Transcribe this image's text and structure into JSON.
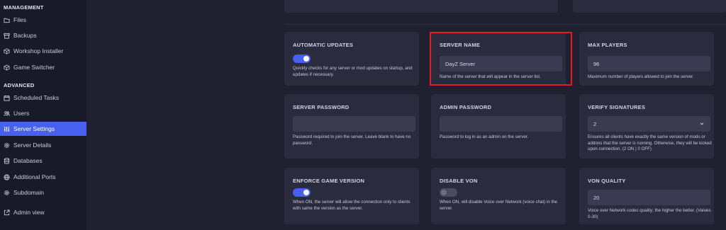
{
  "sidebar": {
    "management_title": "MANAGEMENT",
    "advanced_title": "ADVANCED",
    "management_items": [
      {
        "label": "Files",
        "icon": "folder-icon"
      },
      {
        "label": "Backups",
        "icon": "archive-icon"
      },
      {
        "label": "Workshop Installer",
        "icon": "cube-icon"
      },
      {
        "label": "Game Switcher",
        "icon": "cube-icon"
      }
    ],
    "advanced_items": [
      {
        "label": "Scheduled Tasks",
        "icon": "calendar-icon"
      },
      {
        "label": "Users",
        "icon": "users-icon"
      },
      {
        "label": "Server Settings",
        "icon": "sliders-icon",
        "active": true
      },
      {
        "label": "Server Details",
        "icon": "gear-icon"
      },
      {
        "label": "Databases",
        "icon": "database-icon"
      },
      {
        "label": "Additional Ports",
        "icon": "globe-icon"
      },
      {
        "label": "Subdomain",
        "icon": "gear-icon"
      }
    ],
    "admin_view": "Admin view"
  },
  "settings": {
    "automatic_updates": {
      "title": "AUTOMATIC UPDATES",
      "enabled": true,
      "desc": "Quickly checks for any server or mod updates on startup, and updates if necessary."
    },
    "server_name": {
      "title": "SERVER NAME",
      "value": "DayZ Server",
      "desc": "Name of the server that will appear in the server list."
    },
    "max_players": {
      "title": "MAX PLAYERS",
      "value": "96",
      "desc": "Maximum number of players allowed to join the server."
    },
    "server_password": {
      "title": "SERVER PASSWORD",
      "value": "",
      "desc": "Password required to join the server. Leave blank to have no password."
    },
    "admin_password": {
      "title": "ADMIN PASSWORD",
      "value": "",
      "desc": "Password to log in as an admin on the server."
    },
    "verify_signatures": {
      "title": "VERIFY SIGNATURES",
      "value": "2",
      "desc": "Ensures all clients have exactly the same version of mods or addons that the server is running. Otherwise, they will be kicked upon connection. (2 ON | 0 OFF)"
    },
    "enforce_game_version": {
      "title": "ENFORCE GAME VERSION",
      "enabled": true,
      "desc": "When ON, the server will allow the connection only to clients with same the version as the server."
    },
    "disable_von": {
      "title": "DISABLE VON",
      "enabled": false,
      "desc": "When ON, will disable Voice over Network (voice chat) in the server."
    },
    "von_quality": {
      "title": "VON QUALITY",
      "value": "20",
      "desc": "Voice over Network codec quality; the higher the better. (Values 0-30)"
    }
  },
  "colors": {
    "accent": "#4860f0",
    "highlight": "#e51c23",
    "card": "#2a2b3d",
    "background": "#1f2030"
  }
}
